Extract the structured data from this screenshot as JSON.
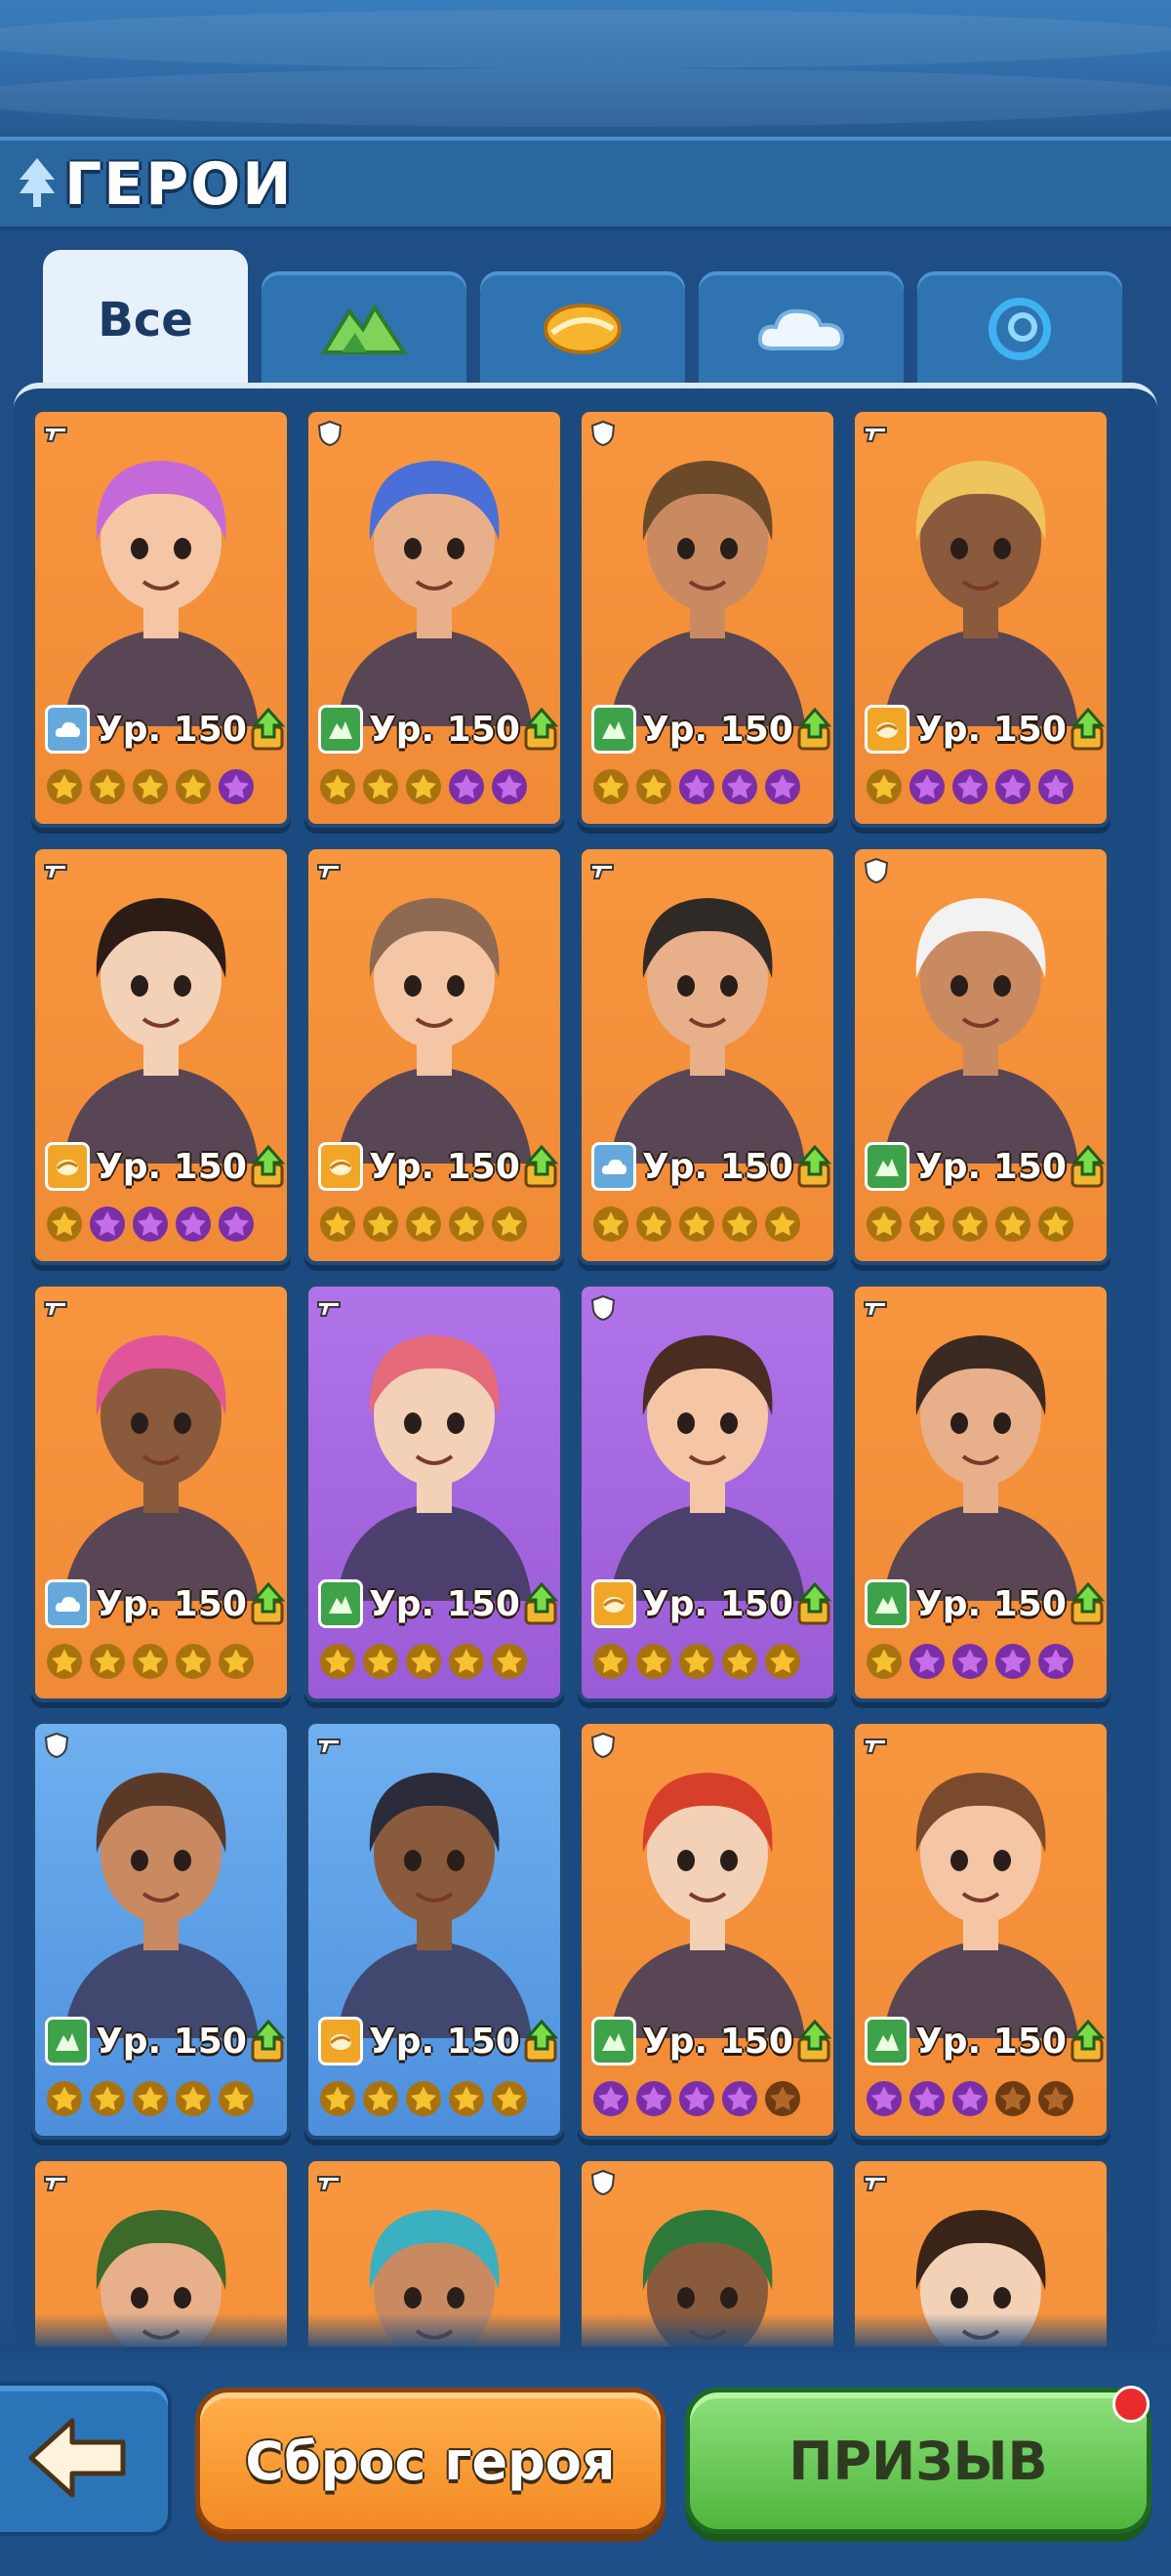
{
  "header": {
    "title": "ГЕРОИ"
  },
  "tabs": [
    {
      "label": "Все",
      "icon": "all",
      "active": true
    },
    {
      "label": "",
      "icon": "mountain-element-icon",
      "active": false
    },
    {
      "label": "",
      "icon": "sand-element-icon",
      "active": false
    },
    {
      "label": "",
      "icon": "cloud-element-icon",
      "active": false
    },
    {
      "label": "",
      "icon": "water-element-icon",
      "active": false
    }
  ],
  "heroes": [
    {
      "role": "gun",
      "bg": "orange",
      "element": "cloud",
      "level": "Ур. 150",
      "stars": [
        "gold",
        "gold",
        "gold",
        "gold",
        "purple"
      ]
    },
    {
      "role": "shield",
      "bg": "orange",
      "element": "mountain",
      "level": "Ур. 150",
      "stars": [
        "gold",
        "gold",
        "gold",
        "purple",
        "purple"
      ]
    },
    {
      "role": "shield",
      "bg": "orange",
      "element": "mountain",
      "level": "Ур. 150",
      "stars": [
        "gold",
        "gold",
        "purple",
        "purple",
        "purple"
      ]
    },
    {
      "role": "gun",
      "bg": "orange",
      "element": "sand",
      "level": "Ур. 150",
      "stars": [
        "gold",
        "purple",
        "purple",
        "purple",
        "purple"
      ]
    },
    {
      "role": "gun",
      "bg": "orange",
      "element": "sand",
      "level": "Ур. 150",
      "stars": [
        "gold",
        "purple",
        "purple",
        "purple",
        "purple"
      ]
    },
    {
      "role": "gun",
      "bg": "orange",
      "element": "sand",
      "level": "Ур. 150",
      "stars": [
        "gold",
        "gold",
        "gold",
        "gold",
        "gold"
      ]
    },
    {
      "role": "gun",
      "bg": "orange",
      "element": "cloud",
      "level": "Ур. 150",
      "stars": [
        "gold",
        "gold",
        "gold",
        "gold",
        "gold"
      ]
    },
    {
      "role": "shield",
      "bg": "orange",
      "element": "mountain",
      "level": "Ур. 150",
      "stars": [
        "gold",
        "gold",
        "gold",
        "gold",
        "gold"
      ]
    },
    {
      "role": "gun",
      "bg": "orange",
      "element": "cloud",
      "level": "Ур. 150",
      "stars": [
        "gold",
        "gold",
        "gold",
        "gold",
        "gold"
      ]
    },
    {
      "role": "gun",
      "bg": "purple",
      "element": "mountain",
      "level": "Ур. 150",
      "stars": [
        "gold",
        "gold",
        "gold",
        "gold",
        "gold"
      ]
    },
    {
      "role": "shield",
      "bg": "purple",
      "element": "sand",
      "level": "Ур. 150",
      "stars": [
        "gold",
        "gold",
        "gold",
        "gold",
        "gold"
      ]
    },
    {
      "role": "gun",
      "bg": "orange",
      "element": "mountain",
      "level": "Ур. 150",
      "stars": [
        "gold",
        "purple",
        "purple",
        "purple",
        "purple"
      ]
    },
    {
      "role": "shield",
      "bg": "blue",
      "element": "mountain",
      "level": "Ур. 150",
      "stars": [
        "gold",
        "gold",
        "gold",
        "gold",
        "gold"
      ]
    },
    {
      "role": "gun",
      "bg": "blue",
      "element": "sand",
      "level": "Ур. 150",
      "stars": [
        "gold",
        "gold",
        "gold",
        "gold",
        "gold"
      ]
    },
    {
      "role": "shield",
      "bg": "orange",
      "element": "mountain",
      "level": "Ур. 150",
      "stars": [
        "purple",
        "purple",
        "purple",
        "purple",
        "empty"
      ]
    },
    {
      "role": "gun",
      "bg": "orange",
      "element": "mountain",
      "level": "Ур. 150",
      "stars": [
        "purple",
        "purple",
        "purple",
        "empty",
        "empty"
      ]
    },
    {
      "role": "gun",
      "bg": "orange",
      "element": "",
      "level": "",
      "stars": []
    },
    {
      "role": "gun",
      "bg": "orange",
      "element": "",
      "level": "",
      "stars": []
    },
    {
      "role": "shield",
      "bg": "orange",
      "element": "",
      "level": "",
      "stars": []
    },
    {
      "role": "gun",
      "bg": "orange",
      "element": "",
      "level": "",
      "stars": []
    }
  ],
  "footer": {
    "reset_label": "Сброс героя",
    "summon_label": "ПРИЗЫВ"
  },
  "colors": {
    "gold_star": "#f6c230",
    "purple_star": "#c46ee8",
    "empty_star": "#b0682a"
  }
}
